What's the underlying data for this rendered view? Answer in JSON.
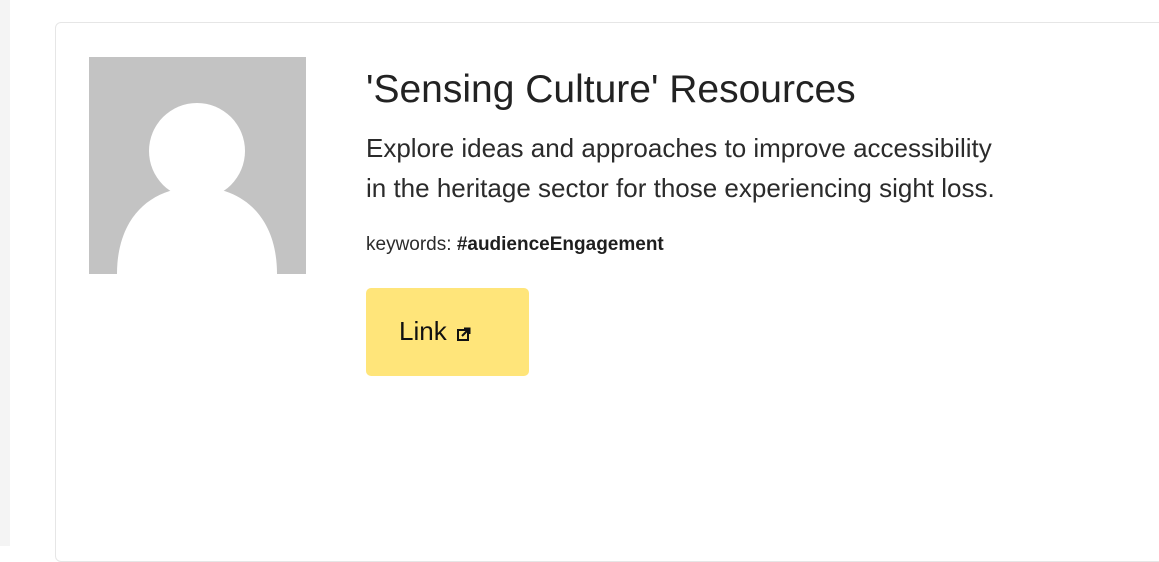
{
  "card": {
    "title": "'Sensing Culture' Resources",
    "description": "Explore ideas and approaches to improve accessibility in the heritage sector for those experiencing sight loss.",
    "keywords_label": "keywords:",
    "keywords_tag": "#audienceEngagement",
    "link_label": "Link",
    "link_icon": "external-link-icon",
    "avatar_icon": "default-user-avatar-icon"
  },
  "colors": {
    "button_background": "#ffe57a",
    "avatar_background": "#c3c3c3",
    "avatar_figure": "#ffffff",
    "card_border": "#e6e6e6"
  }
}
